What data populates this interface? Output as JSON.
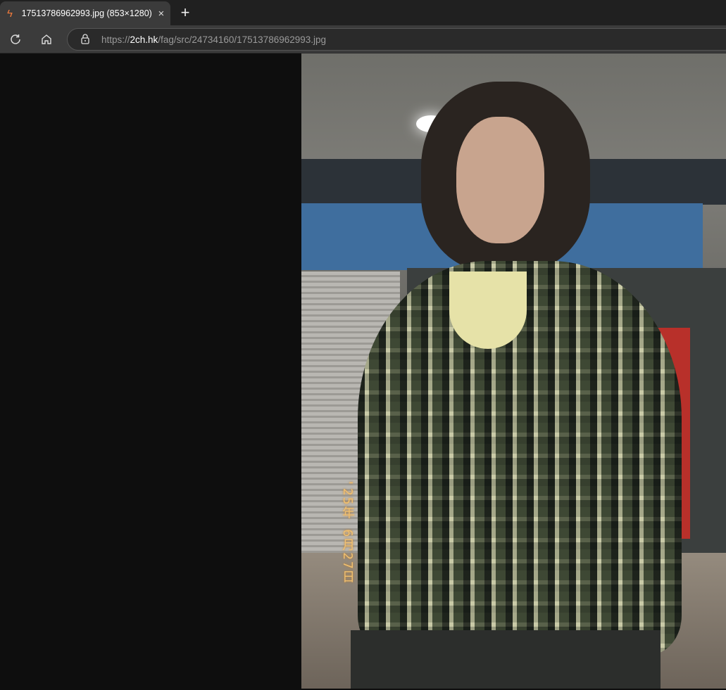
{
  "tab": {
    "title": "17513786962993.jpg (853×1280)",
    "favicon": "bolt-icon",
    "close": "×"
  },
  "new_tab": "+",
  "toolbar": {
    "url_prefix": "https://",
    "url_domain": "2ch.hk",
    "url_path": "/fag/src/24734160/17513786962993.jpg"
  },
  "image": {
    "date_stamp": "'25年 6月27日"
  },
  "colors": {
    "tab_bg": "#3b3b3b",
    "tabbar_bg": "#202020",
    "viewer_bg": "#0e0e0e",
    "favicon": "#f07a3c"
  }
}
